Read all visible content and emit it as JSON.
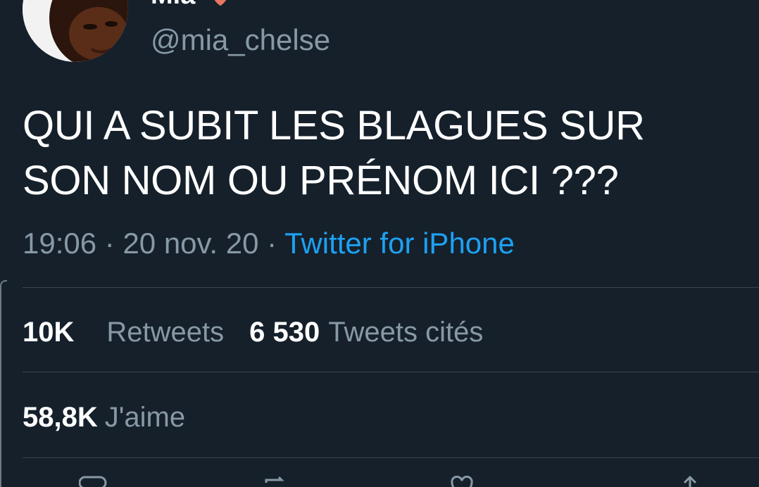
{
  "author": {
    "display_name": "Mia",
    "handle": "@mia_chelse",
    "heart_color": "#e0245e"
  },
  "tweet": {
    "text_line1": "QUI A SUBIT LES BLAGUES SUR",
    "text_line2": "SON NOM OU PRÉNOM ICI ???",
    "time": "19:06",
    "sep1": " · ",
    "date": "20 nov. 20",
    "sep2": " · ",
    "source": "Twitter for iPhone"
  },
  "stats": {
    "retweets_count": "10K",
    "retweets_label": "Retweets",
    "quotes_count": "6 530",
    "quotes_label": "Tweets cités",
    "likes_count": "58,8K",
    "likes_label": "J'aime"
  },
  "colors": {
    "background": "#15202b",
    "text_primary": "#ffffff",
    "text_secondary": "#8899a6",
    "link": "#1da1f2",
    "divider": "#38444d"
  },
  "icons": [
    "reply-icon",
    "retweet-icon",
    "like-icon",
    "share-icon"
  ]
}
